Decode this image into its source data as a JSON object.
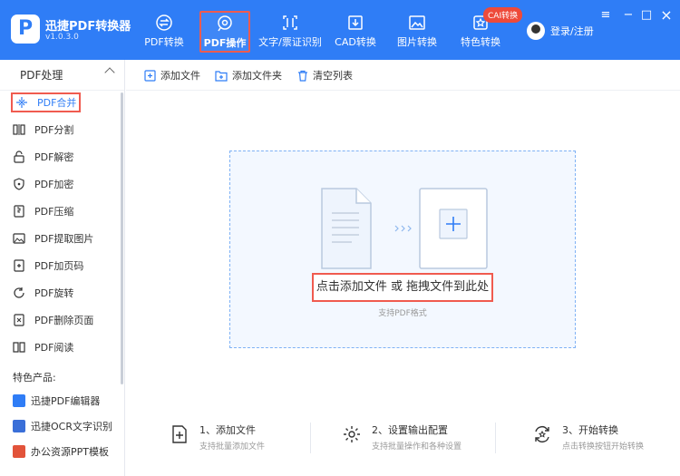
{
  "app": {
    "name": "迅捷PDF转换器",
    "version": "v1.0.3.0",
    "logo_letter": "P"
  },
  "topnav": [
    {
      "label": "PDF转换",
      "icon": "pdf-convert-icon"
    },
    {
      "label": "PDF操作",
      "icon": "pdf-operate-icon",
      "active": true
    },
    {
      "label": "文字/票证识别",
      "icon": "text-recognize-icon"
    },
    {
      "label": "CAD转换",
      "icon": "cad-convert-icon"
    },
    {
      "label": "图片转换",
      "icon": "image-convert-icon"
    },
    {
      "label": "特色转换",
      "icon": "feature-convert-icon"
    }
  ],
  "cai_badge": "CAI转换",
  "login_label": "登录/注册",
  "window_controls": {
    "menu": "≡",
    "minimize": "−",
    "maximize": "□",
    "close": "×"
  },
  "sidebar": {
    "header": "PDF处理",
    "items": [
      {
        "label": "PDF合并",
        "active": true
      },
      {
        "label": "PDF分割"
      },
      {
        "label": "PDF解密"
      },
      {
        "label": "PDF加密"
      },
      {
        "label": "PDF压缩"
      },
      {
        "label": "PDF提取图片"
      },
      {
        "label": "PDF加页码"
      },
      {
        "label": "PDF旋转"
      },
      {
        "label": "PDF删除页面"
      },
      {
        "label": "PDF阅读"
      }
    ],
    "featured_label": "特色产品:",
    "featured": [
      {
        "label": "迅捷PDF编辑器"
      },
      {
        "label": "迅捷OCR文字识别"
      },
      {
        "label": "办公资源PPT模板"
      }
    ]
  },
  "toolbar": {
    "add_file": "添加文件",
    "add_folder": "添加文件夹",
    "clear_list": "清空列表"
  },
  "dropzone": {
    "main": "点击添加文件 或 拖拽文件到此处",
    "sub": "支持PDF格式"
  },
  "steps": [
    {
      "title": "1、添加文件",
      "desc": "支持批量添加文件"
    },
    {
      "title": "2、设置输出配置",
      "desc": "支持批量操作和各种设置"
    },
    {
      "title": "3、开始转换",
      "desc": "点击转换按钮开始转换"
    }
  ],
  "colors": {
    "brand": "#2f7df6",
    "highlight": "#f05b4f",
    "badge": "#ee4a3a"
  }
}
